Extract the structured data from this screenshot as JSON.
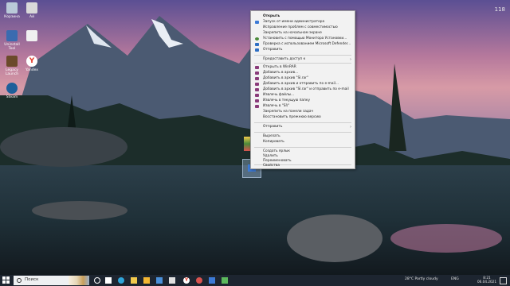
{
  "desktop": {
    "corner_number": "118",
    "icons": [
      {
        "label": "Корзина",
        "color": "#b9c9d8"
      },
      {
        "label": "Ай",
        "color": "#d9d9d9"
      },
      {
        "label": "Uninstall Tool",
        "color": "#3a6bb0"
      },
      {
        "label": "",
        "color": "#f0f0f0"
      },
      {
        "label": "Legacy Launch",
        "color": "#6b4a2b"
      },
      {
        "label": "Yandex",
        "color": "#e43a2a"
      },
      {
        "label": "Steam",
        "color": "#1e5f9a"
      }
    ]
  },
  "context_menu": {
    "items": [
      {
        "label": "Открыть",
        "icon": "",
        "bold": true,
        "arrow": false
      },
      {
        "label": "Запуск от имени администратора",
        "icon": "#3c7ad6",
        "bold": false,
        "arrow": false
      },
      {
        "label": "Исправление проблем с совместимостью",
        "icon": "",
        "bold": false,
        "arrow": false
      },
      {
        "label": "Закрепить на начальном экране",
        "icon": "",
        "bold": false,
        "arrow": false
      },
      {
        "label": "Установить с помощью Монитора Установки...",
        "icon": "#4a8a3a",
        "bold": false,
        "arrow": false
      },
      {
        "label": "Проверка с использованием Microsoft Defender...",
        "icon": "#2f6fc4",
        "bold": false,
        "arrow": false
      },
      {
        "label": "Отправить",
        "icon": "#2f6fc4",
        "bold": false,
        "arrow": false
      },
      {
        "label": "Предоставить доступ к",
        "icon": "",
        "bold": false,
        "arrow": true
      },
      {
        "label": "Открыть в WinRAR",
        "icon": "#8a3b7a",
        "bold": false,
        "arrow": false
      },
      {
        "label": "Добавить в архив...",
        "icon": "#8a3b7a",
        "bold": false,
        "arrow": false
      },
      {
        "label": "Добавить в архив \"Sl.rar\"",
        "icon": "#8a3b7a",
        "bold": false,
        "arrow": false
      },
      {
        "label": "Добавить в архив и отправить по e-mail...",
        "icon": "#8a3b7a",
        "bold": false,
        "arrow": false
      },
      {
        "label": "Добавить в архив \"Sl.rar\" и отправить по e-mail",
        "icon": "#8a3b7a",
        "bold": false,
        "arrow": false
      },
      {
        "label": "Извлечь файлы...",
        "icon": "#8a3b7a",
        "bold": false,
        "arrow": false
      },
      {
        "label": "Извлечь в текущую папку",
        "icon": "#8a3b7a",
        "bold": false,
        "arrow": false
      },
      {
        "label": "Извлечь в \"Sl\\\"",
        "icon": "#8a3b7a",
        "bold": false,
        "arrow": false
      },
      {
        "label": "Закрепить на панели задач",
        "icon": "",
        "bold": false,
        "arrow": false
      },
      {
        "label": "Восстановить прежнюю версию",
        "icon": "",
        "bold": false,
        "arrow": false
      },
      {
        "label": "Отправить",
        "icon": "",
        "bold": false,
        "arrow": true
      },
      {
        "label": "Вырезать",
        "icon": "",
        "bold": false,
        "arrow": false
      },
      {
        "label": "Копировать",
        "icon": "",
        "bold": false,
        "arrow": false
      },
      {
        "label": "Создать ярлык",
        "icon": "",
        "bold": false,
        "arrow": false
      },
      {
        "label": "Удалить",
        "icon": "",
        "bold": false,
        "arrow": false
      },
      {
        "label": "Переименовать",
        "icon": "",
        "bold": false,
        "arrow": false
      },
      {
        "label": "Свойства",
        "icon": "",
        "bold": false,
        "arrow": false
      }
    ]
  },
  "taskbar": {
    "search_placeholder": "Поиск",
    "weather": "28°C  Partly cloudy",
    "language": "ENG",
    "time": "8:21",
    "date": "06.04.2021",
    "pinned": [
      {
        "name": "task-view",
        "color": "#ffffff"
      },
      {
        "name": "edge",
        "color": "#2fa5d9"
      },
      {
        "name": "store",
        "color": "#f2c94c"
      },
      {
        "name": "file-explorer",
        "color": "#f2b632"
      },
      {
        "name": "mail",
        "color": "#4a90d9"
      },
      {
        "name": "yandex",
        "color": "#e43a2a"
      },
      {
        "name": "app-red",
        "color": "#d9534f"
      },
      {
        "name": "app-blue",
        "color": "#3c7ad6"
      },
      {
        "name": "app-green",
        "color": "#5cb85c"
      },
      {
        "name": "app-white",
        "color": "#e0e0e0"
      }
    ]
  }
}
